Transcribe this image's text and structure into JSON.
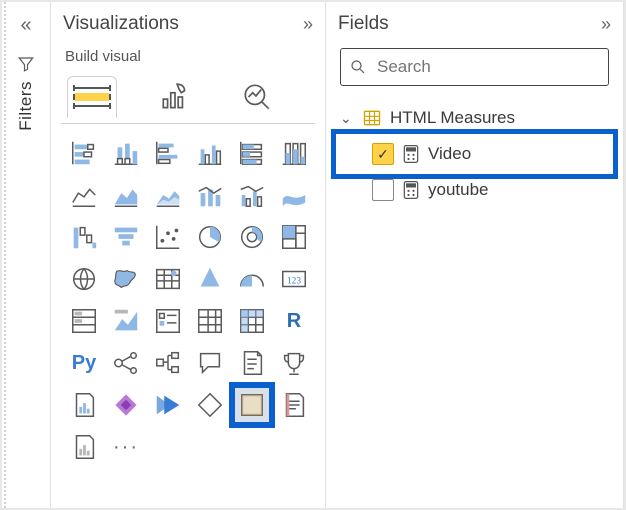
{
  "rail": {
    "filters_label": "Filters"
  },
  "viz": {
    "title": "Visualizations",
    "subhead": "Build visual",
    "tabs": {
      "build": "Build visual",
      "format": "Format visual",
      "analytics": "Analytics"
    },
    "grid": [
      {
        "name": "stacked-bar-chart-icon"
      },
      {
        "name": "stacked-column-chart-icon"
      },
      {
        "name": "clustered-bar-chart-icon"
      },
      {
        "name": "clustered-column-chart-icon"
      },
      {
        "name": "hundred-stacked-bar-icon"
      },
      {
        "name": "hundred-stacked-column-icon"
      },
      {
        "name": "line-chart-icon"
      },
      {
        "name": "area-chart-icon"
      },
      {
        "name": "stacked-area-chart-icon"
      },
      {
        "name": "line-stacked-column-icon"
      },
      {
        "name": "line-clustered-column-icon"
      },
      {
        "name": "ribbon-chart-icon"
      },
      {
        "name": "waterfall-chart-icon"
      },
      {
        "name": "funnel-chart-icon"
      },
      {
        "name": "scatter-chart-icon"
      },
      {
        "name": "pie-chart-icon"
      },
      {
        "name": "donut-chart-icon"
      },
      {
        "name": "treemap-icon"
      },
      {
        "name": "map-icon"
      },
      {
        "name": "filled-map-icon"
      },
      {
        "name": "azure-map-icon"
      },
      {
        "name": "arcgis-map-icon"
      },
      {
        "name": "gauge-icon"
      },
      {
        "name": "card-icon",
        "label": "123"
      },
      {
        "name": "multi-row-card-icon"
      },
      {
        "name": "kpi-icon"
      },
      {
        "name": "slicer-icon"
      },
      {
        "name": "table-icon"
      },
      {
        "name": "matrix-icon"
      },
      {
        "name": "r-visual-icon",
        "label": "R"
      },
      {
        "name": "python-visual-icon",
        "label": "Py"
      },
      {
        "name": "key-influencers-icon"
      },
      {
        "name": "decomposition-tree-icon"
      },
      {
        "name": "qna-icon"
      },
      {
        "name": "smart-narrative-icon"
      },
      {
        "name": "goals-icon"
      },
      {
        "name": "paginated-report-icon"
      },
      {
        "name": "power-apps-icon"
      },
      {
        "name": "power-automate-icon"
      },
      {
        "name": "custom-visual-1-icon"
      },
      {
        "name": "html-content-visual-icon",
        "selected": true
      },
      {
        "name": "custom-visual-2-icon"
      },
      {
        "name": "get-more-visuals-icon"
      },
      {
        "name": "more-options-icon",
        "label": "···"
      }
    ]
  },
  "fields": {
    "title": "Fields",
    "search_placeholder": "Search",
    "tree": {
      "table": "HTML Measures",
      "items": [
        {
          "label": "Video",
          "checked": true,
          "highlighted": true
        },
        {
          "label": "youtube",
          "checked": false,
          "highlighted": false
        }
      ]
    }
  }
}
